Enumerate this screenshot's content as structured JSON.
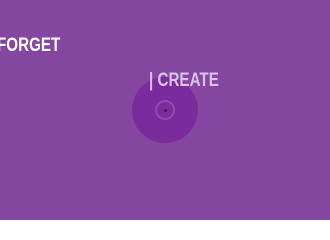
{
  "scene": {
    "words": {
      "left_text": "FORGET",
      "right_text": "| CREATE"
    },
    "icon": {
      "name": "vinyl-record-icon"
    }
  },
  "colors": {
    "background": "#8446a0",
    "left_text": "#ffffff",
    "right_text": "#d9c3e8",
    "disc": "#7a2b9c",
    "disc_ring": "#8c4bad",
    "disc_hole": "#4c135f"
  }
}
